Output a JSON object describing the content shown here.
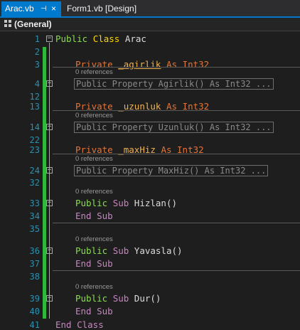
{
  "tabs": [
    {
      "label": "Arac.vb",
      "active": true
    },
    {
      "label": "Form1.vb [Design]",
      "active": false
    }
  ],
  "nav": {
    "scope": "(General)"
  },
  "lines": {
    "n1": "1",
    "n2": "2",
    "n3": "3",
    "n4": "4",
    "n12": "12",
    "n13": "13",
    "n14": "14",
    "n22": "22",
    "n23": "23",
    "n24": "24",
    "n32": "32",
    "n33": "33",
    "n34": "34",
    "n35": "35",
    "n36": "36",
    "n37": "37",
    "n38": "38",
    "n39": "39",
    "n40": "40",
    "n41": "41"
  },
  "code": {
    "public": "Public",
    "class": "Class",
    "class_name": "Arac",
    "private": "Private",
    "as": "As",
    "int32": "Int32",
    "sub": "Sub",
    "end": "End",
    "end_class": "End Class",
    "end_sub": "End Sub",
    "f1": "_agirlik",
    "f2": "_uzunluk",
    "f3": "_maxHiz",
    "p1": "Public Property Agirlik() As Int32 ...",
    "p2": "Public Property Uzunluk() As Int32 ...",
    "p3": "Public Property MaxHiz() As Int32 ...",
    "s1": "Hizlan()",
    "s2": "Yavasla()",
    "s3": "Dur()",
    "refs": "0 references"
  },
  "colors": {
    "accent": "#007acc",
    "change_bar": "#2fb83b",
    "line_number": "#2b91af"
  }
}
